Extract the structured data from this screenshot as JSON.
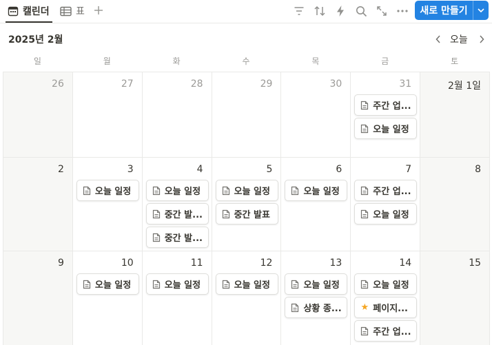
{
  "toolbar": {
    "tabs": [
      {
        "label": "캘린더",
        "icon": "calendar-icon",
        "active": true
      },
      {
        "label": "표",
        "icon": "table-icon",
        "active": false
      }
    ],
    "add_view_icon": "plus-icon",
    "actions": [
      "filter-icon",
      "sort-icon",
      "lightning-icon",
      "search-icon",
      "expand-icon",
      "more-icon"
    ],
    "new_button_label": "새로 만들기",
    "accent": "#2383e2"
  },
  "month": {
    "title": "2025년 2월",
    "today_label": "오늘"
  },
  "weekdays": [
    "일",
    "월",
    "화",
    "수",
    "목",
    "금",
    "토"
  ],
  "weeks": [
    {
      "days": [
        {
          "label": "26",
          "muted": true,
          "weekend": true,
          "events": []
        },
        {
          "label": "27",
          "muted": true,
          "weekend": false,
          "events": []
        },
        {
          "label": "28",
          "muted": true,
          "weekend": false,
          "events": []
        },
        {
          "label": "29",
          "muted": true,
          "weekend": false,
          "events": []
        },
        {
          "label": "30",
          "muted": true,
          "weekend": false,
          "events": []
        },
        {
          "label": "31",
          "muted": true,
          "weekend": false,
          "events": [
            {
              "title": "주간 업...",
              "icon": "page"
            },
            {
              "title": "오늘 일정",
              "icon": "page"
            }
          ]
        },
        {
          "label": "2월 1일",
          "muted": false,
          "weekend": true,
          "events": []
        }
      ]
    },
    {
      "days": [
        {
          "label": "2",
          "muted": false,
          "weekend": true,
          "events": []
        },
        {
          "label": "3",
          "muted": false,
          "weekend": false,
          "events": [
            {
              "title": "오늘 일정",
              "icon": "page"
            }
          ]
        },
        {
          "label": "4",
          "muted": false,
          "weekend": false,
          "events": [
            {
              "title": "오늘 일정",
              "icon": "page"
            },
            {
              "title": "중간 발...",
              "icon": "page"
            },
            {
              "title": "중간 발...",
              "icon": "page"
            }
          ]
        },
        {
          "label": "5",
          "muted": false,
          "weekend": false,
          "events": [
            {
              "title": "오늘 일정",
              "icon": "page"
            },
            {
              "title": "중간 발표",
              "icon": "page"
            }
          ]
        },
        {
          "label": "6",
          "muted": false,
          "weekend": false,
          "events": [
            {
              "title": "오늘 일정",
              "icon": "page"
            }
          ]
        },
        {
          "label": "7",
          "muted": false,
          "weekend": false,
          "events": [
            {
              "title": "주간 업...",
              "icon": "page"
            },
            {
              "title": "오늘 일정",
              "icon": "page"
            }
          ]
        },
        {
          "label": "8",
          "muted": false,
          "weekend": true,
          "events": []
        }
      ]
    },
    {
      "days": [
        {
          "label": "9",
          "muted": false,
          "weekend": true,
          "events": []
        },
        {
          "label": "10",
          "muted": false,
          "weekend": false,
          "events": [
            {
              "title": "오늘 일정",
              "icon": "page"
            }
          ]
        },
        {
          "label": "11",
          "muted": false,
          "weekend": false,
          "events": [
            {
              "title": "오늘 일정",
              "icon": "page"
            }
          ]
        },
        {
          "label": "12",
          "muted": false,
          "weekend": false,
          "events": [
            {
              "title": "오늘 일정",
              "icon": "page"
            }
          ]
        },
        {
          "label": "13",
          "muted": false,
          "weekend": false,
          "events": [
            {
              "title": "오늘 일정",
              "icon": "page"
            },
            {
              "title": "상황 종...",
              "icon": "page"
            }
          ]
        },
        {
          "label": "14",
          "muted": false,
          "weekend": false,
          "events": [
            {
              "title": "오늘 일정",
              "icon": "page"
            },
            {
              "title": "페이지...",
              "icon": "star"
            },
            {
              "title": "주간 업...",
              "icon": "page"
            }
          ]
        },
        {
          "label": "15",
          "muted": false,
          "weekend": true,
          "events": []
        }
      ]
    }
  ]
}
